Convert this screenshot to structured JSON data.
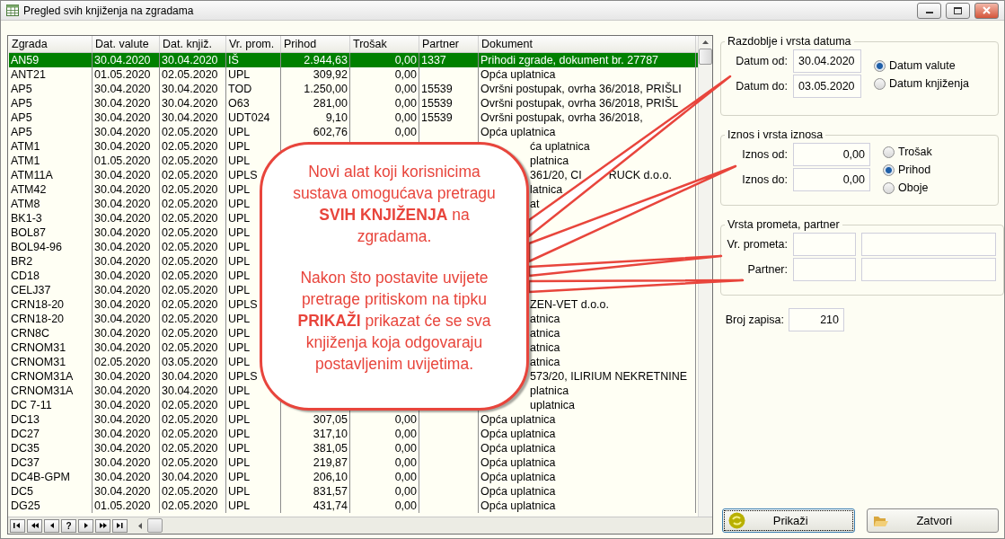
{
  "window": {
    "title": "Pregled svih knjiženja na zgradama"
  },
  "table": {
    "columns": [
      "Zgrada",
      "Dat. valute",
      "Dat. knjiž.",
      "Vr. prom.",
      "Prihod",
      "Trošak",
      "Partner",
      "Dokument"
    ],
    "rows": [
      {
        "selected": true,
        "kind": "full",
        "cells": {
          "zgrada": "AN59",
          "dat_valute": "30.04.2020",
          "dat_knjiz": "30.04.2020",
          "vr_prom": "IŠ",
          "prihod": "2.944,63",
          "trosak": "0,00",
          "partner": "1337",
          "dokument": "Prihodi zgrade, dokument br. 27787"
        }
      },
      {
        "selected": false,
        "kind": "full",
        "cells": {
          "zgrada": "ANT21",
          "dat_valute": "01.05.2020",
          "dat_knjiz": "02.05.2020",
          "vr_prom": "UPL",
          "prihod": "309,92",
          "trosak": "0,00",
          "dokument": "Opća uplatnica"
        }
      },
      {
        "selected": false,
        "kind": "full",
        "cells": {
          "zgrada": "AP5",
          "dat_valute": "30.04.2020",
          "dat_knjiz": "30.04.2020",
          "vr_prom": "TOD",
          "prihod": "1.250,00",
          "trosak": "0,00",
          "partner": "15539",
          "dokument": "Ovršni postupak, ovrha 36/2018, PRIŠLI"
        }
      },
      {
        "selected": false,
        "kind": "full",
        "cells": {
          "zgrada": "AP5",
          "dat_valute": "30.04.2020",
          "dat_knjiz": "30.04.2020",
          "vr_prom": "O63",
          "prihod": "281,00",
          "trosak": "0,00",
          "partner": "15539",
          "dokument": "Ovršni postupak, ovrha 36/2018, PRIŠL"
        }
      },
      {
        "selected": false,
        "kind": "full",
        "cells": {
          "zgrada": "AP5",
          "dat_valute": "30.04.2020",
          "dat_knjiz": "30.04.2020",
          "vr_prom": "UDT024",
          "prihod": "9,10",
          "trosak": "0,00",
          "partner": "15539",
          "dokument": "Ovršni postupak, ovrha 36/2018,"
        }
      },
      {
        "selected": false,
        "kind": "full",
        "cells": {
          "zgrada": "AP5",
          "dat_valute": "30.04.2020",
          "dat_knjiz": "02.05.2020",
          "vr_prom": "UPL",
          "prihod": "602,76",
          "trosak": "0,00",
          "dokument": "Opća uplatnica"
        }
      },
      {
        "selected": false,
        "kind": "partial",
        "cells": {
          "zgrada": "ATM1",
          "dat_valute": "30.04.2020",
          "dat_knjiz": "02.05.2020",
          "vr_prom": "UPL",
          "dokument": "ća uplatnica"
        }
      },
      {
        "selected": false,
        "kind": "partial",
        "cells": {
          "zgrada": "ATM1",
          "dat_valute": "01.05.2020",
          "dat_knjiz": "02.05.2020",
          "vr_prom": "UPL",
          "dokument": "platnica"
        }
      },
      {
        "selected": false,
        "kind": "partial",
        "cells": {
          "zgrada": "ATM11A",
          "dat_valute": "30.04.2020",
          "dat_knjiz": "02.05.2020",
          "vr_prom": "UPLS",
          "dokument": "361/20, CI",
          "dokument_2": "RUCK d.o.o."
        }
      },
      {
        "selected": false,
        "kind": "partial",
        "cells": {
          "zgrada": "ATM42",
          "dat_valute": "30.04.2020",
          "dat_knjiz": "02.05.2020",
          "vr_prom": "UPL",
          "dokument": "latnica"
        }
      },
      {
        "selected": false,
        "kind": "partial",
        "cells": {
          "zgrada": "ATM8",
          "dat_valute": "30.04.2020",
          "dat_knjiz": "02.05.2020",
          "vr_prom": "UPL",
          "dokument": "at"
        }
      },
      {
        "selected": false,
        "kind": "partial",
        "cells": {
          "zgrada": "BK1-3",
          "dat_valute": "30.04.2020",
          "dat_knjiz": "02.05.2020",
          "vr_prom": "UPL"
        }
      },
      {
        "selected": false,
        "kind": "partial",
        "cells": {
          "zgrada": "BOL87",
          "dat_valute": "30.04.2020",
          "dat_knjiz": "02.05.2020",
          "vr_prom": "UPL"
        }
      },
      {
        "selected": false,
        "kind": "partial",
        "cells": {
          "zgrada": "BOL94-96",
          "dat_valute": "30.04.2020",
          "dat_knjiz": "02.05.2020",
          "vr_prom": "UPL"
        }
      },
      {
        "selected": false,
        "kind": "partial",
        "cells": {
          "zgrada": "BR2",
          "dat_valute": "30.04.2020",
          "dat_knjiz": "02.05.2020",
          "vr_prom": "UPL"
        }
      },
      {
        "selected": false,
        "kind": "partial",
        "cells": {
          "zgrada": "CD18",
          "dat_valute": "30.04.2020",
          "dat_knjiz": "02.05.2020",
          "vr_prom": "UPL"
        }
      },
      {
        "selected": false,
        "kind": "partial",
        "cells": {
          "zgrada": "CELJ37",
          "dat_valute": "30.04.2020",
          "dat_knjiz": "02.05.2020",
          "vr_prom": "UPL"
        }
      },
      {
        "selected": false,
        "kind": "partial",
        "cells": {
          "zgrada": "CRN18-20",
          "dat_valute": "30.04.2020",
          "dat_knjiz": "02.05.2020",
          "vr_prom": "UPLS",
          "dokument": "ZEN-VET d.o.o."
        }
      },
      {
        "selected": false,
        "kind": "partial",
        "cells": {
          "zgrada": "CRN18-20",
          "dat_valute": "30.04.2020",
          "dat_knjiz": "02.05.2020",
          "vr_prom": "UPL",
          "dokument": "atnica"
        }
      },
      {
        "selected": false,
        "kind": "partial",
        "cells": {
          "zgrada": "CRN8C",
          "dat_valute": "30.04.2020",
          "dat_knjiz": "02.05.2020",
          "vr_prom": "UPL",
          "dokument": "atnica"
        }
      },
      {
        "selected": false,
        "kind": "partial",
        "cells": {
          "zgrada": "CRNOM31",
          "dat_valute": "30.04.2020",
          "dat_knjiz": "02.05.2020",
          "vr_prom": "UPL",
          "dokument": "atnica"
        }
      },
      {
        "selected": false,
        "kind": "partial",
        "cells": {
          "zgrada": "CRNOM31",
          "dat_valute": "02.05.2020",
          "dat_knjiz": "03.05.2020",
          "vr_prom": "UPL",
          "dokument": "atnica"
        }
      },
      {
        "selected": false,
        "kind": "partial",
        "cells": {
          "zgrada": "CRNOM31A",
          "dat_valute": "30.04.2020",
          "dat_knjiz": "30.04.2020",
          "vr_prom": "UPLS",
          "dokument": "573/20, ILIRIUM NEKRETNINE"
        }
      },
      {
        "selected": false,
        "kind": "partial",
        "cells": {
          "zgrada": "CRNOM31A",
          "dat_valute": "30.04.2020",
          "dat_knjiz": "30.04.2020",
          "vr_prom": "UPL",
          "dokument": "platnica"
        }
      },
      {
        "selected": false,
        "kind": "partial",
        "cells": {
          "zgrada": "DC 7-11",
          "dat_valute": "30.04.2020",
          "dat_knjiz": "02.05.2020",
          "vr_prom": "UPL",
          "dokument": "uplatnica"
        }
      },
      {
        "selected": false,
        "kind": "full",
        "cells": {
          "zgrada": "DC13",
          "dat_valute": "30.04.2020",
          "dat_knjiz": "02.05.2020",
          "vr_prom": "UPL",
          "prihod": "307,05",
          "trosak": "0,00",
          "dokument": "Opća uplatnica"
        }
      },
      {
        "selected": false,
        "kind": "full",
        "cells": {
          "zgrada": "DC27",
          "dat_valute": "30.04.2020",
          "dat_knjiz": "02.05.2020",
          "vr_prom": "UPL",
          "prihod": "317,10",
          "trosak": "0,00",
          "dokument": "Opća uplatnica"
        }
      },
      {
        "selected": false,
        "kind": "full",
        "cells": {
          "zgrada": "DC35",
          "dat_valute": "30.04.2020",
          "dat_knjiz": "02.05.2020",
          "vr_prom": "UPL",
          "prihod": "381,05",
          "trosak": "0,00",
          "dokument": "Opća uplatnica"
        }
      },
      {
        "selected": false,
        "kind": "full",
        "cells": {
          "zgrada": "DC37",
          "dat_valute": "30.04.2020",
          "dat_knjiz": "02.05.2020",
          "vr_prom": "UPL",
          "prihod": "219,87",
          "trosak": "0,00",
          "dokument": "Opća uplatnica"
        }
      },
      {
        "selected": false,
        "kind": "full",
        "cells": {
          "zgrada": "DC4B-GPM",
          "dat_valute": "30.04.2020",
          "dat_knjiz": "30.04.2020",
          "vr_prom": "UPL",
          "prihod": "206,10",
          "trosak": "0,00",
          "dokument": "Opća uplatnica"
        }
      },
      {
        "selected": false,
        "kind": "full",
        "cells": {
          "zgrada": "DC5",
          "dat_valute": "30.04.2020",
          "dat_knjiz": "02.05.2020",
          "vr_prom": "UPL",
          "prihod": "831,57",
          "trosak": "0,00",
          "dokument": "Opća uplatnica"
        }
      },
      {
        "selected": false,
        "kind": "full",
        "cells": {
          "zgrada": "DG25",
          "dat_valute": "01.05.2020",
          "dat_knjiz": "02.05.2020",
          "vr_prom": "UPL",
          "prihod": "431,74",
          "trosak": "0,00",
          "dokument": "Opća uplatnica"
        }
      }
    ]
  },
  "navigator": {
    "help": "?"
  },
  "callout": {
    "paragraphs": [
      "Novi alat koji korisnicima\nsustava omogućava pretragu\n**SVIH KNJIŽENJA** na\nzgradama.",
      "Nakon što postavite uvijete\npretrage pritiskom na tipku\n**PRIKAŽI** prikazat će se sva\nknjiženja koja odgovaraju\npostavljenim uvijetima."
    ]
  },
  "date_group": {
    "title": "Razdoblje i vrsta datuma",
    "fields": [
      {
        "label": "Datum od:",
        "value": "30.04.2020"
      },
      {
        "label": "Datum do:",
        "value": "03.05.2020"
      }
    ],
    "options": [
      {
        "label": "Datum valute",
        "selected": true
      },
      {
        "label": "Datum knjiženja",
        "selected": false
      }
    ]
  },
  "amount_group": {
    "title": "Iznos i vrsta iznosa",
    "fields": [
      {
        "label": "Iznos od:",
        "value": "0,00"
      },
      {
        "label": "Iznos do:",
        "value": "0,00"
      }
    ],
    "options": [
      {
        "label": "Trošak",
        "selected": false
      },
      {
        "label": "Prihod",
        "selected": true
      },
      {
        "label": "Oboje",
        "selected": false
      }
    ]
  },
  "partner_group": {
    "title": "Vrsta prometa, partner",
    "fields": [
      {
        "label": "Vr. prometa:"
      },
      {
        "label": "Partner:"
      }
    ]
  },
  "record_count": {
    "label": "Broj zapisa:",
    "value": "210"
  },
  "buttons": [
    {
      "label": "Prikaži",
      "kind": "refresh",
      "focused": true
    },
    {
      "label": "Zatvori",
      "kind": "folder",
      "focused": false
    }
  ]
}
